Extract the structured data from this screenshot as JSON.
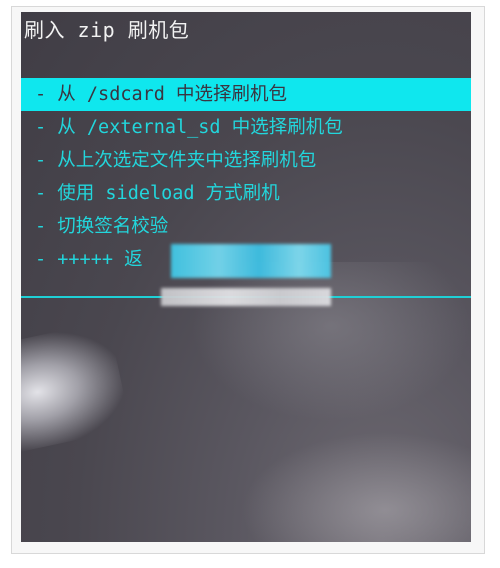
{
  "screen": {
    "title": "刷入 zip 刷机包",
    "menu": [
      {
        "label": "- 从 /sdcard 中选择刷机包",
        "selected": true
      },
      {
        "label": "- 从 /external_sd 中选择刷机包",
        "selected": false
      },
      {
        "label": "- 从上次选定文件夹中选择刷机包",
        "selected": false
      },
      {
        "label": "- 使用 sideload 方式刷机",
        "selected": false
      },
      {
        "label": "- 切换签名校验",
        "selected": false
      },
      {
        "label": "- +++++ 返",
        "selected": false
      }
    ]
  },
  "colors": {
    "highlight": "#0fe7ee",
    "menu_text": "#22d6dc",
    "title_text": "#f2f2f2"
  }
}
